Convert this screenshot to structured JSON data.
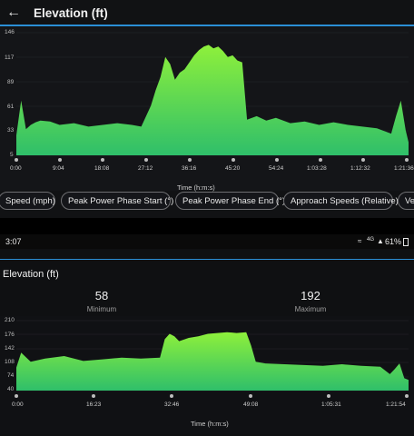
{
  "header": {
    "title": "Elevation (ft)",
    "back_icon": "arrow-left-icon"
  },
  "chart1": {
    "x_title": "Time (h:m:s)",
    "y_ticks": [
      "146",
      "117",
      "89",
      "61",
      "33",
      "5"
    ],
    "x_ticks": [
      "0:00",
      "9:04",
      "18:08",
      "27:12",
      "36:16",
      "45:20",
      "54:24",
      "1:03:28",
      "1:12:32",
      "1:21:36"
    ]
  },
  "chips": [
    "Speed (mph)",
    "Peak Power Phase Start (°)",
    "Peak Power Phase End (°)",
    "Approach Speeds (Relative)",
    "Ve"
  ],
  "status_bar": {
    "time": "3:07",
    "battery": "61%",
    "network": "4G"
  },
  "chart2_panel": {
    "title": "Elevation (ft)",
    "min_value": "58",
    "min_label": "Minimum",
    "max_value": "192",
    "max_label": "Maximum"
  },
  "chart2": {
    "x_title": "Time (h:m:s)",
    "y_ticks": [
      "210",
      "176",
      "142",
      "108",
      "74",
      "40"
    ],
    "x_ticks": [
      "0:00",
      "16:23",
      "32:46",
      "49:08",
      "1:05:31",
      "1:21:54"
    ]
  },
  "colors": {
    "accent": "#2b8fd6",
    "fill_top": "#8ef03b",
    "fill_bottom": "#2fbf6a"
  },
  "chart_data": [
    {
      "type": "area",
      "title": "Elevation (ft)",
      "xlabel": "Time (h:m:s)",
      "ylabel": "",
      "ylim": [
        5,
        146
      ],
      "x_minutes": [
        0,
        1,
        2,
        3,
        4,
        5,
        7,
        9,
        12,
        15,
        18,
        21,
        24,
        26,
        28,
        29,
        30,
        31,
        32,
        33,
        34,
        35,
        36,
        37,
        38,
        39,
        40,
        41,
        42,
        43,
        44,
        45,
        46,
        47,
        48,
        50,
        52,
        54,
        57,
        60,
        63,
        66,
        69,
        72,
        75,
        78,
        79,
        80,
        81,
        81.6
      ],
      "y": [
        28,
        68,
        35,
        40,
        43,
        45,
        44,
        40,
        42,
        38,
        40,
        42,
        40,
        38,
        62,
        80,
        95,
        118,
        110,
        92,
        100,
        104,
        112,
        120,
        126,
        130,
        132,
        128,
        130,
        125,
        118,
        120,
        114,
        112,
        46,
        50,
        45,
        48,
        42,
        44,
        40,
        43,
        40,
        38,
        36,
        30,
        50,
        68,
        34,
        20
      ]
    },
    {
      "type": "area",
      "title": "Elevation (ft)",
      "xlabel": "Time (h:m:s)",
      "ylabel": "",
      "ylim": [
        40,
        210
      ],
      "x_minutes": [
        0,
        1,
        3,
        6,
        10,
        14,
        18,
        22,
        26,
        30,
        31,
        32,
        33,
        34,
        36,
        38,
        40,
        42,
        44,
        46,
        48,
        49,
        50,
        52,
        56,
        60,
        64,
        68,
        72,
        76,
        78,
        79,
        80,
        81,
        81.9
      ],
      "y": [
        96,
        132,
        110,
        118,
        124,
        112,
        116,
        120,
        118,
        120,
        165,
        178,
        172,
        160,
        168,
        172,
        178,
        180,
        182,
        180,
        182,
        150,
        110,
        106,
        104,
        102,
        100,
        104,
        100,
        98,
        80,
        92,
        106,
        70,
        66
      ]
    }
  ]
}
